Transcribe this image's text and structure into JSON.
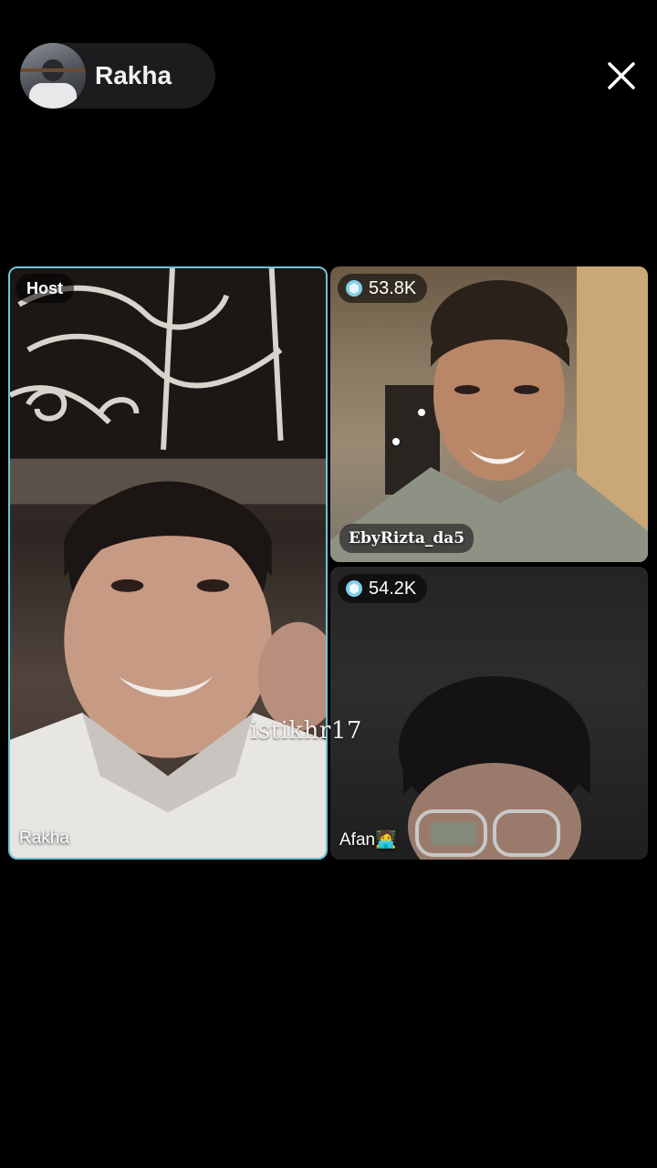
{
  "header": {
    "host_name": "Rakha",
    "close_icon": "close-icon"
  },
  "tiles": [
    {
      "role_badge": "Host",
      "name": "Rakha"
    },
    {
      "coins": "53.8K",
      "name": "EbyRizta_da5"
    },
    {
      "coins": "54.2K",
      "name": "Afan",
      "name_emoji": "🧑‍💻"
    }
  ],
  "watermark": "istikhr17",
  "colors": {
    "host_border": "#6fc3dc",
    "coin": "#7fd0ea",
    "background": "#000000"
  }
}
